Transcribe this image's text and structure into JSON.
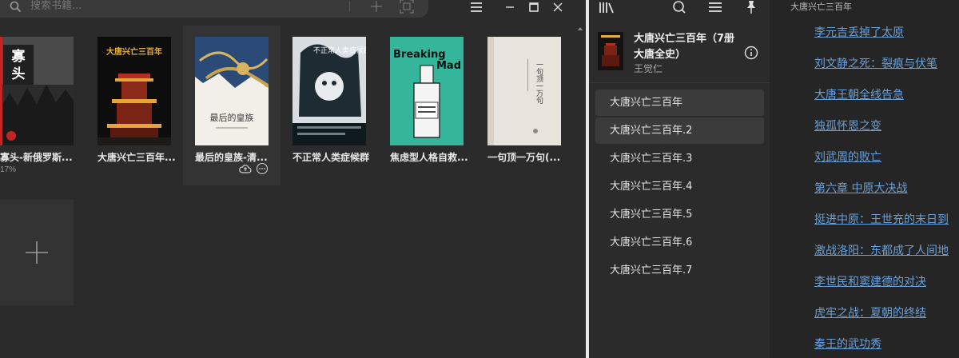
{
  "search": {
    "placeholder": "搜索书籍..."
  },
  "books": [
    {
      "title": "寡头-新俄罗斯...",
      "progress": "17%"
    },
    {
      "title": "大唐兴亡三百年..."
    },
    {
      "title": "最后的皇族-清..."
    },
    {
      "title": "不正常人类症候群"
    },
    {
      "title": "焦虑型人格自救..."
    },
    {
      "title": "一句顶一万句(..."
    }
  ],
  "covers": {
    "b1": {
      "main": "寡",
      "sub": "头"
    },
    "b2": {
      "title": "大唐兴亡三百年"
    },
    "b3": {
      "title": "最后的皇族"
    },
    "b4": {
      "title": "不正常人类症候群"
    },
    "b5": {
      "word1": "Breaking",
      "word2": "Mad"
    },
    "b6": {
      "title": "一句顶一万句"
    }
  },
  "current_book": {
    "title": "大唐兴亡三百年（7册大唐全史）",
    "author": "王觉仁"
  },
  "toc": [
    "大唐兴亡三百年",
    "大唐兴亡三百年.2",
    "大唐兴亡三百年.3",
    "大唐兴亡三百年.4",
    "大唐兴亡三百年.5",
    "大唐兴亡三百年.6",
    "大唐兴亡三百年.7"
  ],
  "chapters": {
    "header": "大唐兴亡三百年",
    "items": [
      "李元吉丢掉了太原",
      "刘文静之死：裂痕与伏笔",
      "大唐王朝全线告急",
      "独孤怀恩之变",
      "刘武周的败亡",
      "第六章 中原大决战",
      "挺进中原：王世充的末日到",
      "激战洛阳：东都成了人间地",
      "李世民和窦建德的对决",
      "虎牢之战：夏朝的终结",
      "秦王的武功秀"
    ]
  },
  "colors": {
    "link": "#6aa0d8",
    "accent_teal": "#35b59a",
    "divider": "#e8e8e8"
  }
}
